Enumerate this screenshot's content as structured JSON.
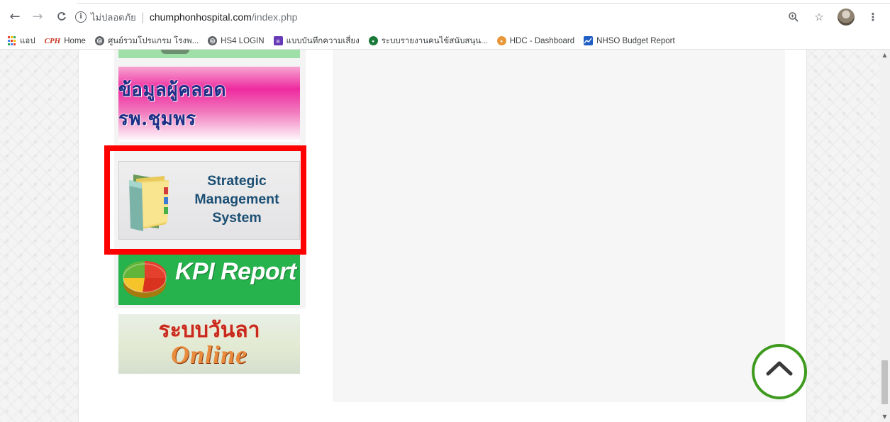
{
  "browser": {
    "security_label": "ไม่ปลอดภัย",
    "url_host": "chumphonhospital.com",
    "url_path": "/index.php",
    "icons": [
      "back-icon",
      "forward-icon",
      "reload-icon",
      "info-icon",
      "zoom-icon",
      "star-icon",
      "avatar",
      "menu-icon"
    ]
  },
  "bookmarks": [
    {
      "label": "แอป",
      "icon": "apps-icon"
    },
    {
      "label": "Home",
      "icon": "cph-logo"
    },
    {
      "label": "ศูนย์รวมโปรแกรม โรงพ...",
      "icon": "globe-icon"
    },
    {
      "label": "HS4 LOGIN",
      "icon": "globe-icon"
    },
    {
      "label": "แบบบันทึกความเสี่ยง",
      "icon": "form-icon"
    },
    {
      "label": "ระบบรายงานคนไข้สนับสนุน...",
      "icon": "green-icon"
    },
    {
      "label": "HDC - Dashboard",
      "icon": "hdc-icon"
    },
    {
      "label": "NHSO Budget Report",
      "icon": "chart-icon"
    }
  ],
  "sidebar": {
    "birth_banner": "ข้อมูลผู้คลอด รพ.ชุมพร",
    "strategic_lines": [
      "Strategic",
      "Management",
      "System"
    ],
    "kpi_banner": "KPI Report",
    "leave_thai": "ระบบวันลา",
    "leave_online": "Online"
  },
  "colors": {
    "highlight": "#fe0000",
    "kpi_green": "#26b24c",
    "scroll_top_ring": "#3f9b1f",
    "birth_pink": "#ee2a9f"
  }
}
